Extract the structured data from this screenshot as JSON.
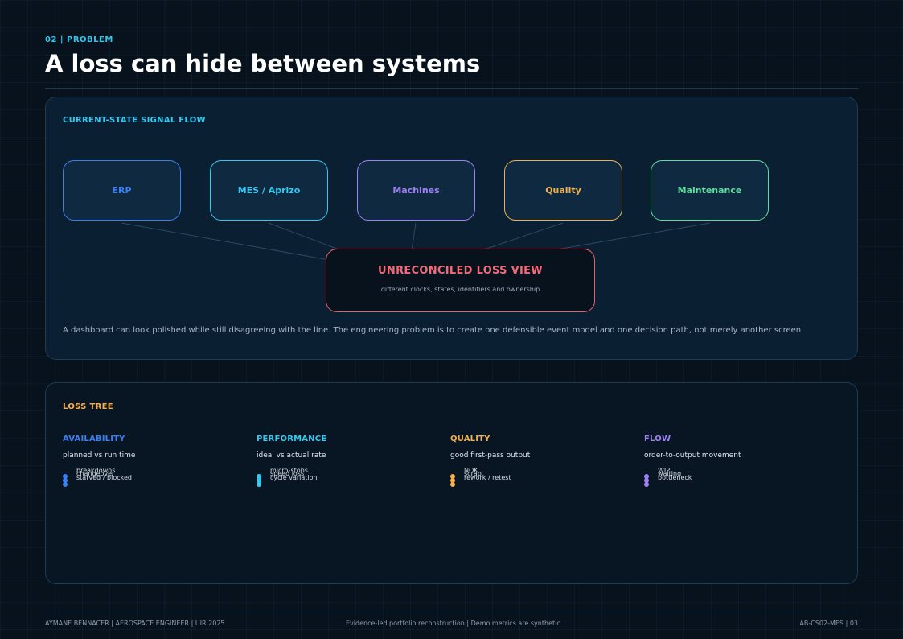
{
  "header": {
    "kicker": "02 | PROBLEM",
    "title": "A loss can hide between systems"
  },
  "signal_flow": {
    "label": "CURRENT-STATE SIGNAL FLOW",
    "systems": [
      {
        "label": "ERP",
        "color": "#3b7ff0"
      },
      {
        "label": "MES / Aprizo",
        "color": "#33c9f0"
      },
      {
        "label": "Machines",
        "color": "#a080f5"
      },
      {
        "label": "Quality",
        "color": "#f3b04a"
      },
      {
        "label": "Maintenance",
        "color": "#5edc9e"
      }
    ],
    "loss_view": {
      "title": "UNRECONCILED LOSS VIEW",
      "subtitle": "different clocks, states, identifiers and ownership",
      "color": "#f06a78"
    },
    "description": "A dashboard can look polished while still disagreeing with the line. The engineering problem is to create one defensible event model and one decision path, not merely another screen."
  },
  "loss_tree": {
    "label": "LOSS TREE",
    "categories": [
      {
        "title": "AVAILABILITY",
        "color": "#3b7ff0",
        "subtitle": "planned vs run time",
        "items": [
          "breakdowns",
          "changeover",
          "starved / blocked"
        ]
      },
      {
        "title": "PERFORMANCE",
        "color": "#33c9f0",
        "subtitle": "ideal vs actual rate",
        "items": [
          "micro-stops",
          "speed loss",
          "cycle variation"
        ]
      },
      {
        "title": "QUALITY",
        "color": "#f3b04a",
        "subtitle": "good first-pass output",
        "items": [
          "NOK",
          "scrap",
          "rework / retest"
        ]
      },
      {
        "title": "FLOW",
        "color": "#a080f5",
        "subtitle": "order-to-output movement",
        "items": [
          "WIP",
          "waiting",
          "bottleneck"
        ]
      }
    ]
  },
  "footer": {
    "left": "AYMANE BENNACER | AEROSPACE ENGINEER | UIR 2025",
    "center": "Evidence-led portfolio reconstruction | Demo metrics are synthetic",
    "right": "AB-CS02-MES | 03"
  }
}
